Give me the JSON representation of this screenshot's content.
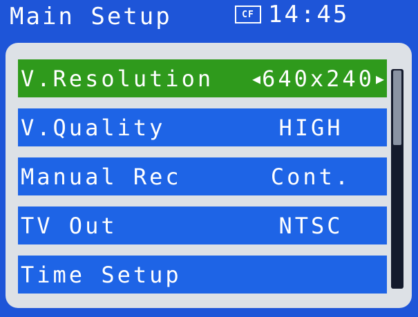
{
  "header": {
    "title": "Main Setup",
    "media_badge": "CF",
    "time": "14:45"
  },
  "menu": {
    "items": [
      {
        "label": "V.Resolution",
        "value": "640x240",
        "selected": true,
        "left_arrow": "◀",
        "right_arrow": "▶"
      },
      {
        "label": "V.Quality",
        "value": "HIGH",
        "selected": false
      },
      {
        "label": "Manual Rec",
        "value": "Cont.",
        "selected": false
      },
      {
        "label": "TV Out",
        "value": "NTSC",
        "selected": false
      },
      {
        "label": "Time Setup",
        "value": "",
        "selected": false
      }
    ]
  },
  "colors": {
    "background": "#1e55d8",
    "item": "#1e64e6",
    "selected_item": "#2f9a1c",
    "panel": "#dde1e6",
    "text": "#ffffff"
  }
}
